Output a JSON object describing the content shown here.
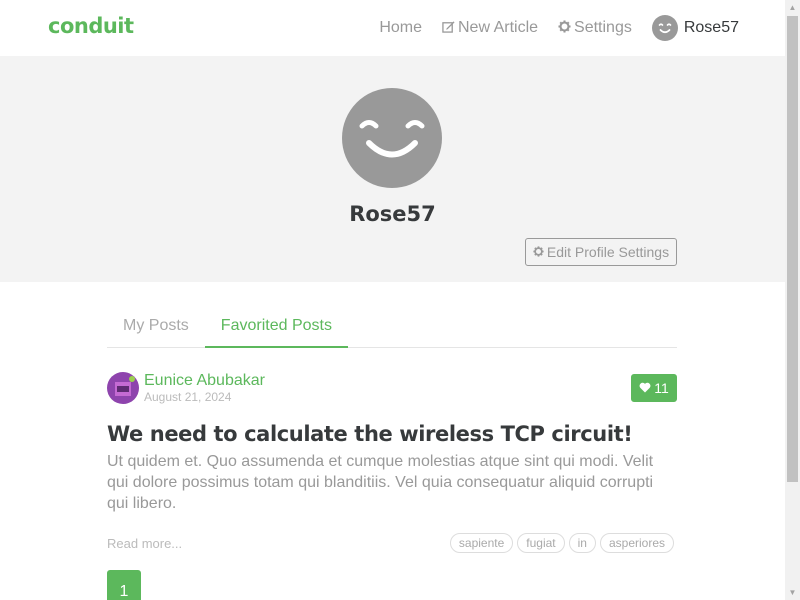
{
  "nav": {
    "brand": "conduit",
    "home": "Home",
    "new_article": "New Article",
    "settings": "Settings",
    "username": "Rose57",
    "new_article_icon": "edit-icon",
    "settings_icon": "gear-icon"
  },
  "profile": {
    "username": "Rose57",
    "edit_button": "Edit Profile Settings",
    "edit_icon": "gear-icon"
  },
  "tabs": [
    {
      "label": "My Posts",
      "active": false
    },
    {
      "label": "Favorited Posts",
      "active": true
    }
  ],
  "article": {
    "author": "Eunice Abubakar",
    "date": "August 21, 2024",
    "favorites_count": "11",
    "title": "We need to calculate the wireless TCP circuit!",
    "description": "Ut quidem et. Quo assumenda et cumque molestias atque sint qui modi. Velit qui dolore possimus totam qui blanditiis. Vel quia consequatur aliquid corrupti qui libero.",
    "read_more": "Read more...",
    "tags": [
      "sapiente",
      "fugiat",
      "in",
      "asperiores"
    ]
  },
  "pagination": {
    "pages": [
      "1"
    ],
    "current": "1"
  },
  "colors": {
    "accent": "#5cb85c",
    "banner_bg": "#f3f3f3",
    "muted": "#999999"
  }
}
